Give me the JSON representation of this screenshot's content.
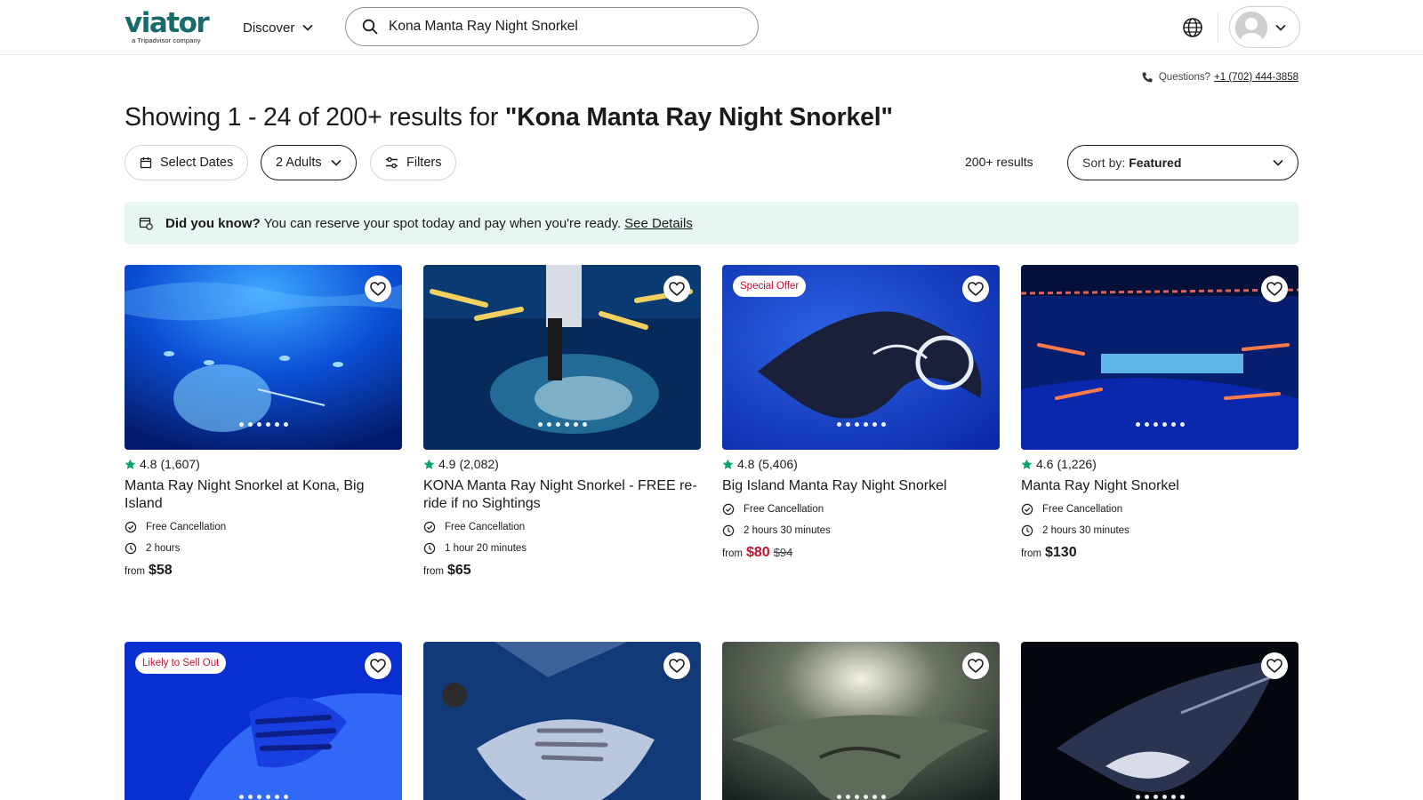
{
  "header": {
    "logo": "viator",
    "logo_sub": "a Tripadvisor company",
    "discover": "Discover",
    "search_value": "Kona Manta Ray Night Snorkel"
  },
  "questions": {
    "label": "Questions?",
    "phone": "+1 (702) 444-3858"
  },
  "results": {
    "prefix": "Showing 1 - 24 of 200+ results for ",
    "query": "\"Kona Manta Ray Night Snorkel\"",
    "count": "200+ results"
  },
  "filters": {
    "dates": "Select Dates",
    "adults": "2 Adults",
    "filters": "Filters",
    "sort_label": "Sort by:",
    "sort_value": "Featured"
  },
  "banner": {
    "bold": "Did you know?",
    "text": "You can reserve your spot today and pay when you're ready.",
    "link": "See Details"
  },
  "colors": {
    "brand": "#186b6d",
    "star": "#04a36b",
    "sale": "#c8102e",
    "banner_bg": "#e7f6f2"
  },
  "cards": [
    {
      "rating": "4.8",
      "reviews": "(1,607)",
      "title": "Manta Ray Night Snorkel at Kona, Big Island",
      "cancel": "Free Cancellation",
      "duration": "2 hours",
      "from": "from",
      "price": "$58"
    },
    {
      "rating": "4.9",
      "reviews": "(2,082)",
      "title": "KONA Manta Ray Night Snorkel - FREE re-ride if no Sightings",
      "cancel": "Free Cancellation",
      "duration": "1 hour 20 minutes",
      "from": "from",
      "price": "$65"
    },
    {
      "badge": "Special Offer",
      "rating": "4.8",
      "reviews": "(5,406)",
      "title": "Big Island Manta Ray Night Snorkel",
      "cancel": "Free Cancellation",
      "duration": "2 hours 30 minutes",
      "from": "from",
      "price": "$80",
      "old_price": "$94"
    },
    {
      "rating": "4.6",
      "reviews": "(1,226)",
      "title": "Manta Ray Night Snorkel",
      "cancel": "Free Cancellation",
      "duration": "2 hours 30 minutes",
      "from": "from",
      "price": "$130"
    },
    {
      "badge": "Likely to Sell Out"
    },
    {},
    {},
    {}
  ]
}
